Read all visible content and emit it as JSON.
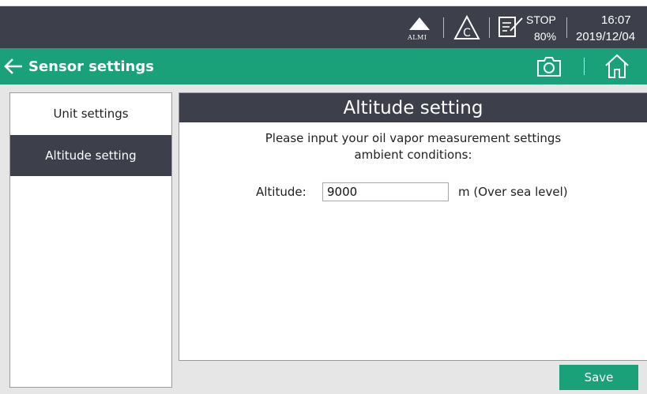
{
  "status_bar": {
    "alarm_label": "ALMI",
    "run_state": "STOP",
    "battery": "80%",
    "time": "16:07",
    "date": "2019/12/04"
  },
  "title_bar": {
    "title": "Sensor settings",
    "icons": [
      "back-arrow-icon",
      "camera-icon",
      "home-icon"
    ]
  },
  "sidebar": {
    "items": [
      {
        "label": "Unit settings",
        "active": false
      },
      {
        "label": "Altitude setting",
        "active": true
      }
    ]
  },
  "panel": {
    "title": "Altitude setting",
    "prompt_line1": "Please input your oil vapor measurement settings",
    "prompt_line2": "ambient conditions:",
    "altitude_label": "Altitude:",
    "altitude_value": "9000",
    "altitude_unit": "m (Over sea level)"
  },
  "save_label": "Save",
  "colors": {
    "dark": "#3d3f4a",
    "accent": "#1aa17a",
    "background": "#e6e6e6"
  }
}
